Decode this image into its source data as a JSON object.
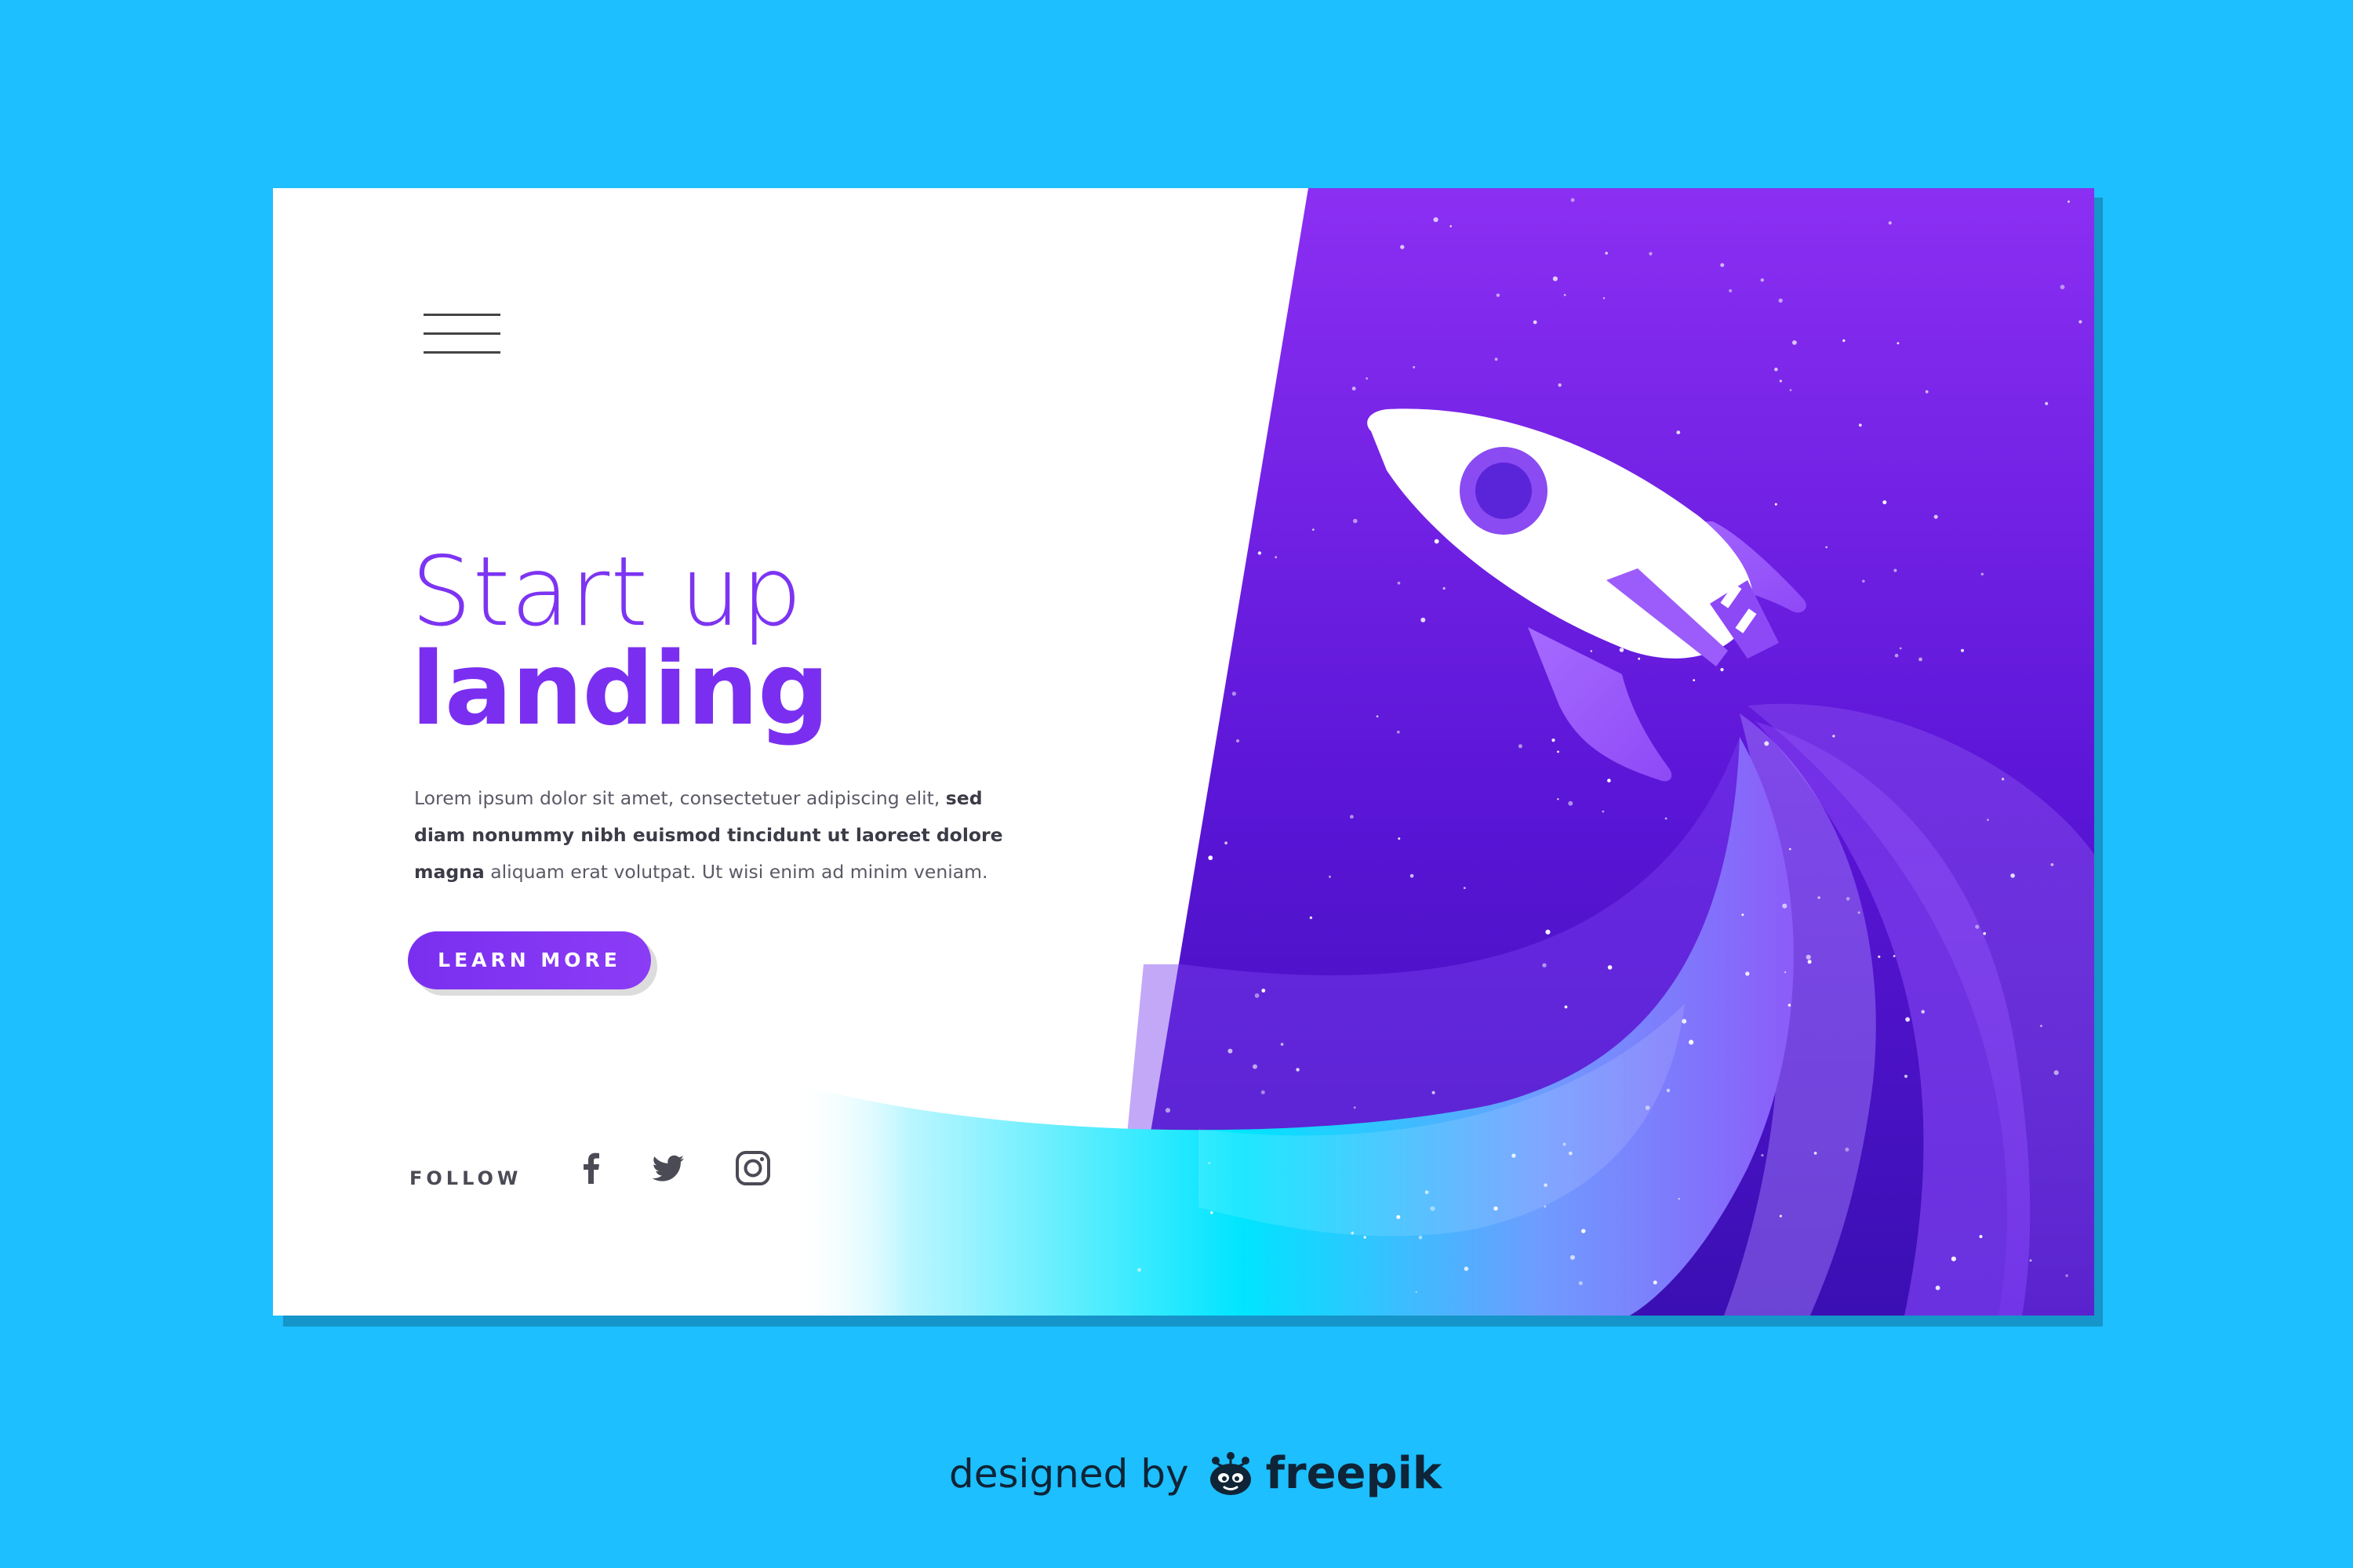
{
  "hero": {
    "title_line1": "Start up",
    "title_line2": "landing",
    "body_plain_1": "Lorem ipsum dolor sit amet, consectetuer adipiscing elit, ",
    "body_bold": "sed diam nonummy nibh euismod tincidunt ut laoreet dolore magna",
    "body_plain_2": " aliquam erat volutpat. Ut wisi enim ad minim veniam.",
    "cta_label": "LEARN MORE"
  },
  "social": {
    "follow_label": "FOLLOW",
    "icons": [
      "facebook-icon",
      "twitter-icon",
      "instagram-icon"
    ]
  },
  "credit": {
    "prefix": "designed by",
    "brand": "freepik"
  },
  "colors": {
    "page_background": "#1dbfff",
    "card_background": "#ffffff",
    "accent_purple": "#7a2ff0",
    "space_top": "#8b2ff3",
    "space_bottom": "#3a0fb3",
    "trail_cyan": "#00e5ff",
    "text_gray": "#5a5a66"
  }
}
